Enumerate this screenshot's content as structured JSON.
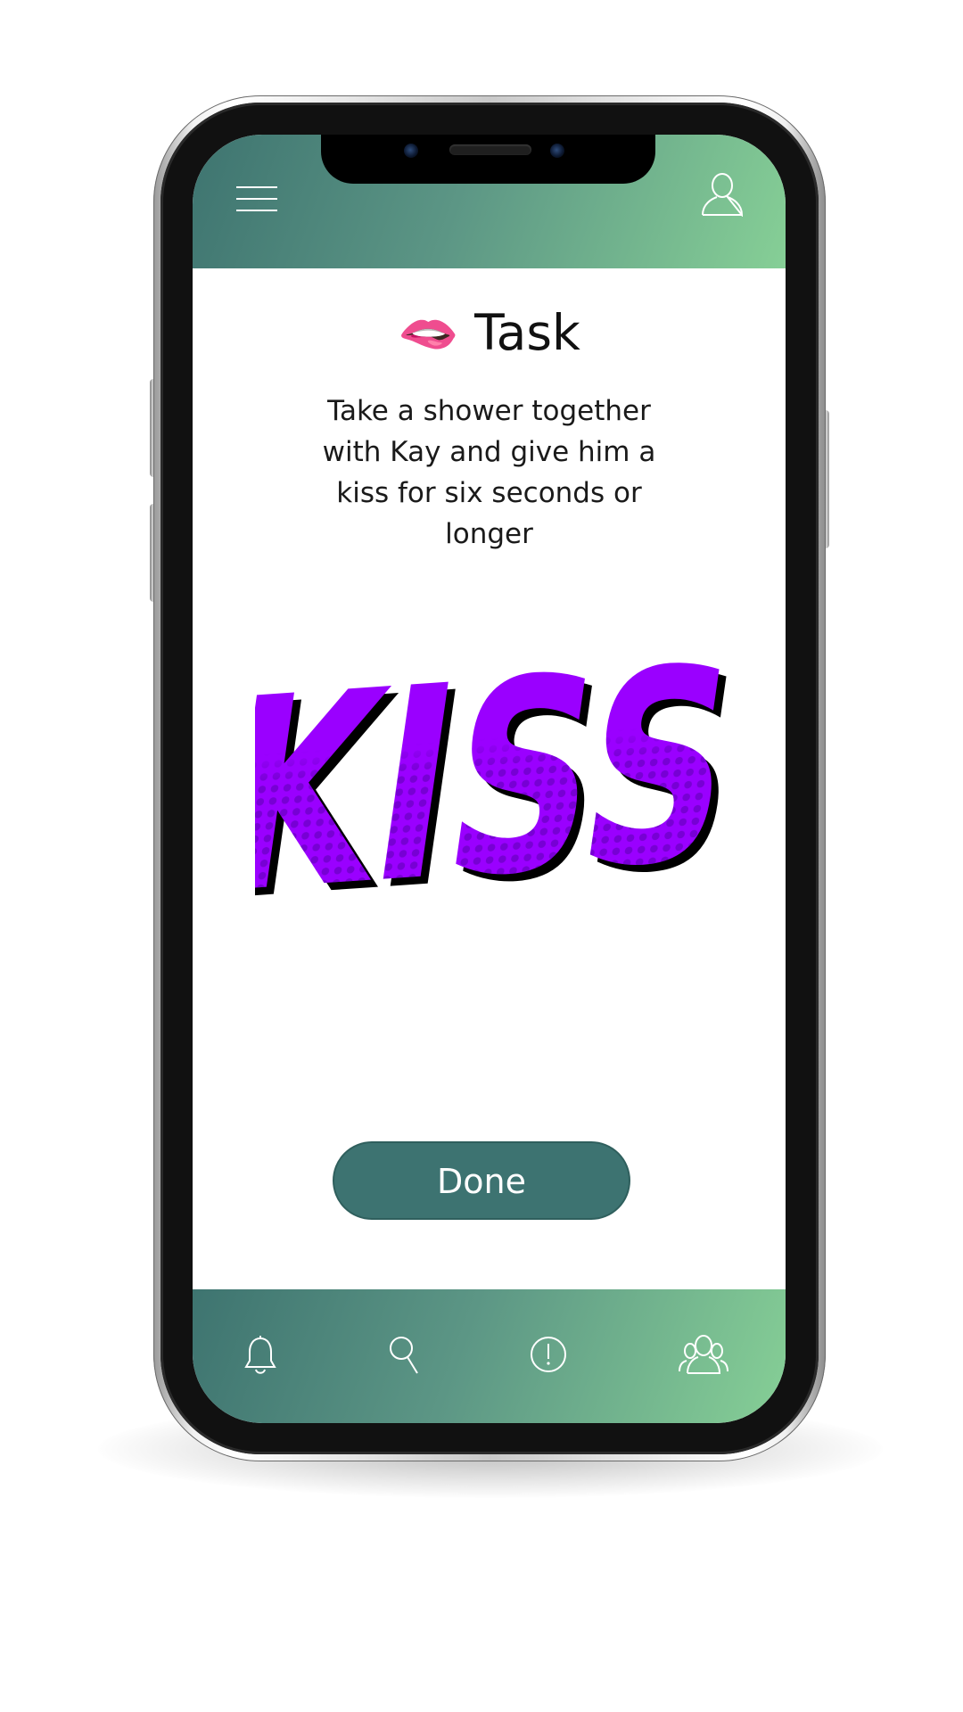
{
  "task": {
    "title": "🫦 Task",
    "description": "Take a shower together with Kay and give him a kiss for six seconds or longer",
    "sticker_text": "KISS",
    "done_label": "Done"
  },
  "header": {
    "menu_icon": "hamburger-menu-icon",
    "profile_icon": "user-profile-icon"
  },
  "footer": {
    "items": [
      {
        "icon": "bell-icon"
      },
      {
        "icon": "search-icon"
      },
      {
        "icon": "alert-info-icon"
      },
      {
        "icon": "group-users-icon"
      }
    ]
  },
  "colors": {
    "gradient_start": "#3e7470",
    "gradient_end": "#86cf96",
    "button": "#3d7371",
    "kiss_purple": "#9a00ff"
  }
}
